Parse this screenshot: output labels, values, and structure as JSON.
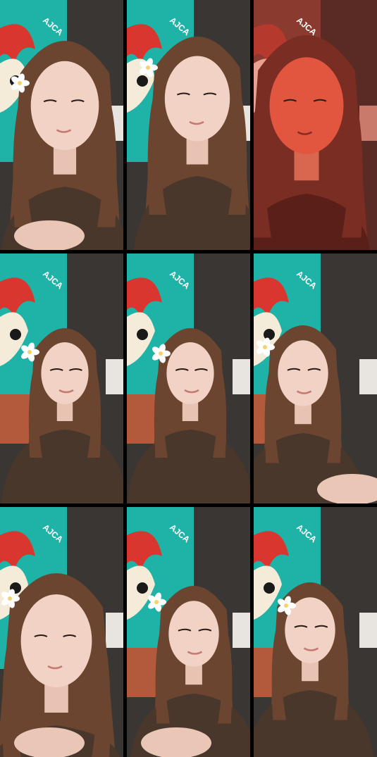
{
  "collage": {
    "rows": 3,
    "columns": 3,
    "frames": [
      {
        "tone": "warm",
        "flower": true,
        "background": "teal-mural",
        "pose": "smiling, head tilted down"
      },
      {
        "tone": "warm",
        "flower": true,
        "background": "teal-mural",
        "pose": "eyes half closed"
      },
      {
        "tone": "red-filter",
        "flower": false,
        "background": "teal-mural",
        "pose": "looking down, mouth open"
      },
      {
        "tone": "warm",
        "flower": true,
        "background": "teal-mural-brick",
        "pose": "head tilted, leaning back"
      },
      {
        "tone": "warm",
        "flower": true,
        "background": "teal-mural-brick",
        "pose": "facing camera, mouth slightly open"
      },
      {
        "tone": "warm",
        "flower": true,
        "background": "teal-mural-brick",
        "pose": "turned to side, talking"
      },
      {
        "tone": "warm",
        "flower": true,
        "background": "teal-mural",
        "pose": "close-up, looking down"
      },
      {
        "tone": "warm",
        "flower": true,
        "background": "teal-mural-brick",
        "pose": "facing camera"
      },
      {
        "tone": "warm",
        "flower": true,
        "background": "teal-mural-brick",
        "pose": "looking down"
      }
    ],
    "mural_text": "AJCA",
    "colors": {
      "divider": "#000000",
      "mural_teal": "#1fb3a8",
      "hair": "#6b4530",
      "skin": "#f1d2c4",
      "red_filter": "#e2553f",
      "brick": "#b35a3c",
      "ceiling": "#3a3634"
    }
  }
}
